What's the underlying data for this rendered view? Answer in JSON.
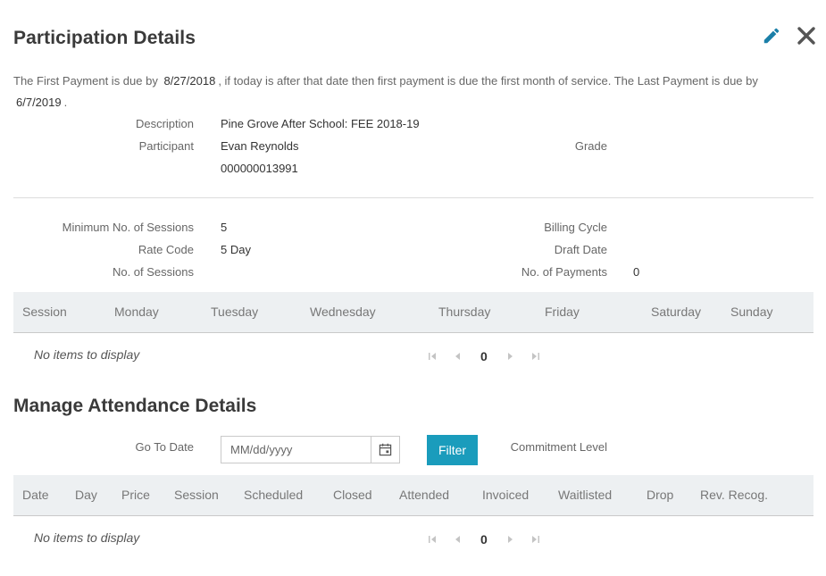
{
  "header": {
    "title": "Participation Details"
  },
  "note": {
    "prefix": "The First Payment is due by",
    "first_date": "8/27/2018",
    "middle": ", if today is after that date then first payment is due the first month of service. The Last Payment is due by",
    "last_date": "6/7/2019",
    "suffix": "."
  },
  "details": {
    "description_label": "Description",
    "description_value": "Pine Grove After School: FEE 2018-19",
    "participant_label": "Participant",
    "participant_name": "Evan Reynolds",
    "participant_id": "000000013991",
    "grade_label": "Grade"
  },
  "billing": {
    "min_sessions_label": "Minimum No. of Sessions",
    "min_sessions_value": "5",
    "rate_code_label": "Rate Code",
    "rate_code_value": "5 Day",
    "num_sessions_label": "No. of Sessions",
    "billing_cycle_label": "Billing Cycle",
    "draft_date_label": "Draft Date",
    "num_payments_label": "No. of Payments",
    "num_payments_value": "0"
  },
  "sessions_grid": {
    "columns": [
      "Session",
      "Monday",
      "Tuesday",
      "Wednesday",
      "Thursday",
      "Friday",
      "Saturday",
      "Sunday"
    ],
    "empty_text": "No items to display",
    "page": "0"
  },
  "attendance": {
    "title": "Manage Attendance Details",
    "go_to_date_label": "Go To Date",
    "date_placeholder": "MM/dd/yyyy",
    "filter_label": "Filter",
    "commitment_label": "Commitment Level",
    "columns": [
      "Date",
      "Day",
      "Price",
      "Session",
      "Scheduled",
      "Closed",
      "Attended",
      "Invoiced",
      "Waitlisted",
      "Drop",
      "Rev. Recog."
    ],
    "empty_text": "No items to display",
    "page": "0"
  },
  "colors": {
    "accent": "#1a9cbc",
    "grid_header_bg": "#edf0f2"
  },
  "icons": {
    "edit": "pencil-icon",
    "close": "close-icon",
    "calendar": "calendar-icon"
  }
}
